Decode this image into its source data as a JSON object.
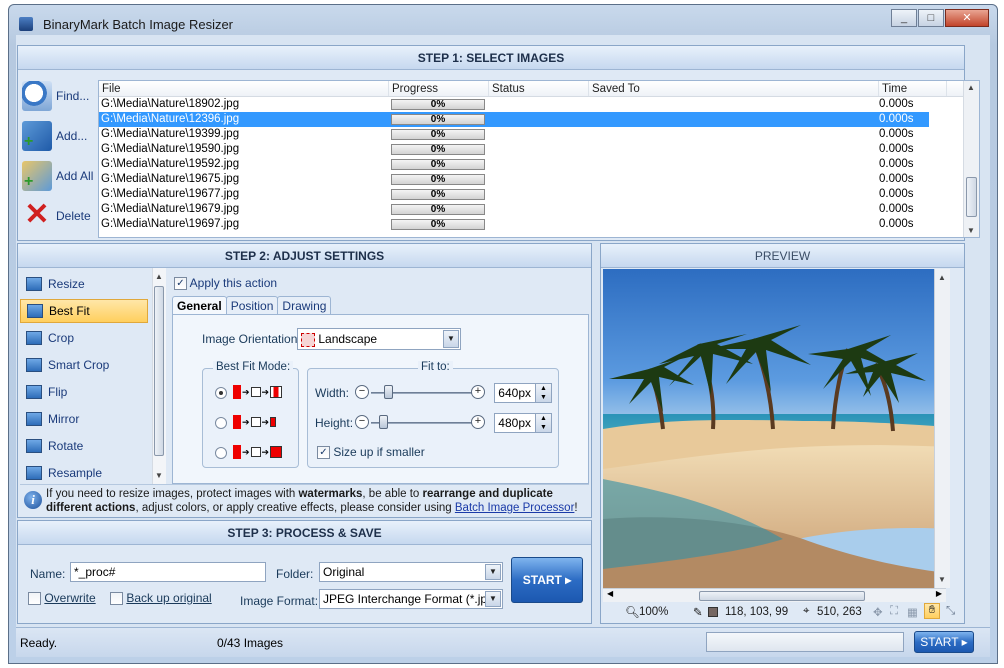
{
  "window": {
    "title": "BinaryMark Batch Image Resizer",
    "min": "_",
    "max": "□",
    "close": "✕"
  },
  "step1": {
    "header": "STEP 1: SELECT IMAGES",
    "buttons": [
      {
        "label": "Find...",
        "icon": "find-icon"
      },
      {
        "label": "Add...",
        "icon": "add-icon"
      },
      {
        "label": "Add All",
        "icon": "add-all-icon"
      },
      {
        "label": "Delete",
        "icon": "delete-icon"
      }
    ],
    "columns": [
      "File",
      "Progress",
      "Status",
      "Saved To",
      "Time"
    ],
    "rows": [
      {
        "file": "G:\\Media\\Nature\\18902.jpg",
        "progress": "0%",
        "status": "",
        "saved": "",
        "time": "0.000s"
      },
      {
        "file": "G:\\Media\\Nature\\12396.jpg",
        "progress": "0%",
        "status": "",
        "saved": "",
        "time": "0.000s"
      },
      {
        "file": "G:\\Media\\Nature\\19399.jpg",
        "progress": "0%",
        "status": "",
        "saved": "",
        "time": "0.000s"
      },
      {
        "file": "G:\\Media\\Nature\\19590.jpg",
        "progress": "0%",
        "status": "",
        "saved": "",
        "time": "0.000s"
      },
      {
        "file": "G:\\Media\\Nature\\19592.jpg",
        "progress": "0%",
        "status": "",
        "saved": "",
        "time": "0.000s"
      },
      {
        "file": "G:\\Media\\Nature\\19675.jpg",
        "progress": "0%",
        "status": "",
        "saved": "",
        "time": "0.000s"
      },
      {
        "file": "G:\\Media\\Nature\\19677.jpg",
        "progress": "0%",
        "status": "",
        "saved": "",
        "time": "0.000s"
      },
      {
        "file": "G:\\Media\\Nature\\19679.jpg",
        "progress": "0%",
        "status": "",
        "saved": "",
        "time": "0.000s"
      },
      {
        "file": "G:\\Media\\Nature\\19697.jpg",
        "progress": "0%",
        "status": "",
        "saved": "",
        "time": "0.000s"
      }
    ],
    "selected_index": 1
  },
  "step2": {
    "header": "STEP 2: ADJUST SETTINGS",
    "actions": [
      "Resize",
      "Best Fit",
      "Crop",
      "Smart Crop",
      "Flip",
      "Mirror",
      "Rotate",
      "Resample"
    ],
    "selected_action": "Best Fit",
    "apply_label": "Apply this action",
    "apply_checked": true,
    "tabs": [
      "General",
      "Position",
      "Drawing"
    ],
    "active_tab": "General",
    "orientation_label": "Image Orientation:",
    "orientation_value": "Landscape",
    "bestfit_label": "Best Fit Mode:",
    "fitto_label": "Fit to:",
    "width_label": "Width:",
    "width_value": "640px",
    "height_label": "Height:",
    "height_value": "480px",
    "sizeup_label": "Size up if smaller",
    "sizeup_checked": true,
    "info_text_1": "If you need to resize images, protect images with ",
    "info_bold_1": "watermarks",
    "info_text_2": ", be able to ",
    "info_bold_2": "rearrange and duplicate different actions",
    "info_text_3": ", adjust colors, or apply creative effects, please consider using ",
    "info_link": "Batch Image Processor",
    "info_text_4": "!"
  },
  "step3": {
    "header": "STEP 3: PROCESS & SAVE",
    "name_label": "Name:",
    "name_value": "*_proc#",
    "folder_label": "Folder:",
    "folder_value": "Original",
    "overwrite_label": "Overwrite",
    "backup_label": "Back up original",
    "format_label": "Image Format:",
    "format_value": "JPEG Interchange Format (*.jpg,",
    "start_label": "START"
  },
  "preview": {
    "header": "PREVIEW",
    "zoom": "100%",
    "color": "118, 103, 99",
    "coords": "510, 263"
  },
  "statusbar": {
    "status": "Ready.",
    "count": "0/43 Images",
    "start_label": "START"
  }
}
